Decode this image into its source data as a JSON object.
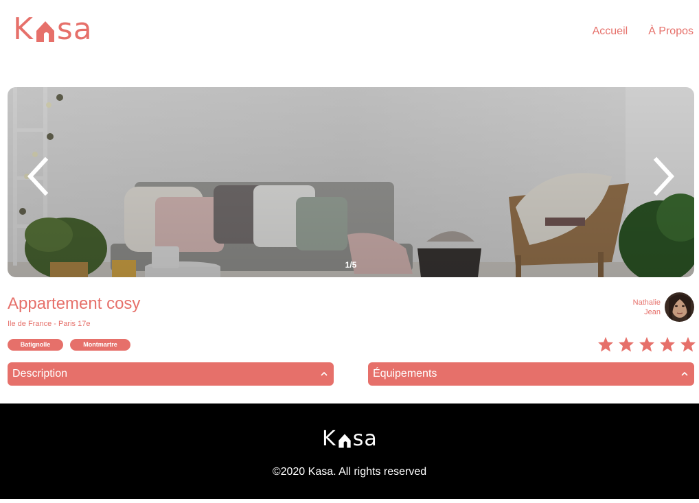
{
  "header": {
    "logo": {
      "letter_k": "K",
      "letters_rest": "sa",
      "brand_color": "#E6706A"
    },
    "nav": [
      {
        "label": "Accueil"
      },
      {
        "label": "À Propos"
      }
    ]
  },
  "gallery": {
    "counter": "1/5",
    "prev_icon": "chevron-left-icon",
    "next_icon": "chevron-right-icon"
  },
  "listing": {
    "title": "Appartement cosy",
    "location": "Ile de France - Paris 17e",
    "tags": [
      "Batignolle",
      "Montmartre"
    ],
    "host": {
      "first_name": "Nathalie",
      "last_name": "Jean"
    },
    "rating": 5,
    "rating_max": 5
  },
  "collapses": [
    {
      "label": "Description",
      "icon": "chevron-up-icon"
    },
    {
      "label": "Équipements",
      "icon": "chevron-up-icon"
    }
  ],
  "footer": {
    "logo": {
      "letter_k": "K",
      "letters_rest": "sa"
    },
    "copyright": "©2020 Kasa. All rights reserved"
  },
  "colors": {
    "accent": "#E6706A",
    "footer_bg": "#000000",
    "star_active": "#E6706A"
  }
}
